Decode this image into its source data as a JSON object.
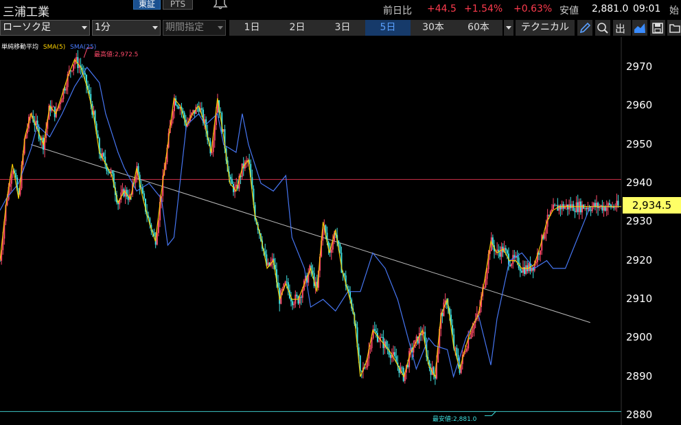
{
  "header": {
    "stock_name": "三浦工業",
    "market_tabs": [
      "東証",
      "PTS"
    ],
    "prev_day_label": "前日比",
    "change": "+44.5",
    "change_pct": "+1.54%",
    "change_pct2": "+0.63%",
    "low_label": "安値",
    "low_value": "2,881.0",
    "time": "09:01",
    "open_label": "始"
  },
  "toolbar": {
    "chart_type": "ローソク足",
    "interval": "1分",
    "period_label": "期間指定",
    "ranges": [
      "1日",
      "2日",
      "3日",
      "5日",
      "30本",
      "60本"
    ],
    "active_range": "5日",
    "technical_label": "テクニカル"
  },
  "legend": {
    "title": "単純移動平均",
    "sma5": "SMA(5)",
    "sma25": "SMA(25)"
  },
  "annotations": {
    "high": "最高値:2,972.5",
    "low": "最安値:2,881.0"
  },
  "colors": {
    "up": "#ff4a6a",
    "down": "#3ee0e0",
    "sma5": "#ffd400",
    "sma25": "#4a7cff",
    "accent_active": "#5aa0ff",
    "change_color": "#ff3b4e",
    "current_price_bg": "#ffff66"
  },
  "chart_data": {
    "type": "line",
    "current_price": "2,934.5",
    "high": 2972.5,
    "low": 2881.0,
    "ylim": [
      2878,
      2976
    ],
    "yticks": [
      2970,
      2960,
      2950,
      2940,
      2930,
      2920,
      2910,
      2900,
      2890,
      2880
    ],
    "resistance_level": 2941,
    "trendline": [
      [
        5,
        2950
      ],
      [
        95,
        2904
      ]
    ],
    "series": [
      {
        "name": "SMA(25)",
        "x": [
          0,
          1,
          3,
          5,
          6,
          8,
          10,
          12,
          14,
          16,
          17,
          19,
          20,
          22,
          24,
          26,
          27,
          28,
          30,
          32,
          33,
          35,
          36,
          38,
          39,
          40,
          42,
          44,
          46,
          47,
          49,
          50,
          52,
          54,
          56,
          58,
          60,
          62,
          64,
          65,
          67,
          69,
          70,
          72,
          73,
          75,
          77,
          79,
          80,
          82,
          84,
          86,
          88,
          89,
          91,
          93,
          95,
          97,
          100
        ],
        "values": [
          2933,
          2936,
          2940,
          2949,
          2955,
          2952,
          2958,
          2965,
          2970,
          2966,
          2958,
          2948,
          2944,
          2938,
          2940,
          2936,
          2924,
          2926,
          2955,
          2958,
          2955,
          2958,
          2950,
          2948,
          2958,
          2950,
          2940,
          2938,
          2942,
          2926,
          2918,
          2908,
          2910,
          2907,
          2912,
          2912,
          2922,
          2918,
          2910,
          2904,
          2892,
          2900,
          2898,
          2897,
          2890,
          2900,
          2906,
          2893,
          2905,
          2920,
          2922,
          2918,
          2920,
          2918,
          2918,
          2926,
          2934,
          2934,
          2934
        ]
      },
      {
        "name": "SMA(5)",
        "x": [
          0,
          1,
          2,
          3,
          4,
          5,
          6,
          7,
          8,
          9,
          10,
          11,
          12,
          13,
          14,
          15,
          16,
          17,
          18,
          19,
          20,
          21,
          22,
          23,
          24,
          25,
          26,
          27,
          28,
          29,
          30,
          31,
          32,
          33,
          34,
          35,
          36,
          37,
          38,
          39,
          40,
          41,
          42,
          43,
          44,
          45,
          46,
          47,
          48,
          49,
          50,
          51,
          52,
          53,
          54,
          55,
          56,
          57,
          58,
          59,
          60,
          61,
          62,
          63,
          64,
          65,
          66,
          67,
          68,
          69,
          70,
          71,
          72,
          73,
          74,
          75,
          76,
          77,
          78,
          79,
          80,
          81,
          82,
          83,
          84,
          85,
          86,
          87,
          88,
          89,
          90,
          91,
          92,
          93,
          94,
          95,
          96,
          97,
          98,
          99,
          100
        ],
        "values": [
          2920,
          2935,
          2945,
          2936,
          2952,
          2958,
          2954,
          2950,
          2960,
          2958,
          2963,
          2968,
          2972,
          2970,
          2965,
          2958,
          2948,
          2945,
          2942,
          2935,
          2938,
          2936,
          2944,
          2936,
          2930,
          2925,
          2938,
          2950,
          2962,
          2960,
          2955,
          2958,
          2960,
          2955,
          2948,
          2962,
          2952,
          2940,
          2938,
          2944,
          2946,
          2932,
          2926,
          2918,
          2920,
          2910,
          2914,
          2910,
          2910,
          2914,
          2918,
          2912,
          2930,
          2922,
          2928,
          2918,
          2912,
          2906,
          2890,
          2894,
          2902,
          2900,
          2898,
          2896,
          2893,
          2890,
          2896,
          2899,
          2902,
          2893,
          2890,
          2906,
          2910,
          2898,
          2892,
          2898,
          2903,
          2906,
          2915,
          2925,
          2922,
          2923,
          2920,
          2920,
          2918,
          2918,
          2919,
          2924,
          2930,
          2933,
          2934,
          2934,
          2934,
          2934,
          2934,
          2934,
          2934,
          2934,
          2934,
          2934,
          2934
        ]
      }
    ]
  }
}
